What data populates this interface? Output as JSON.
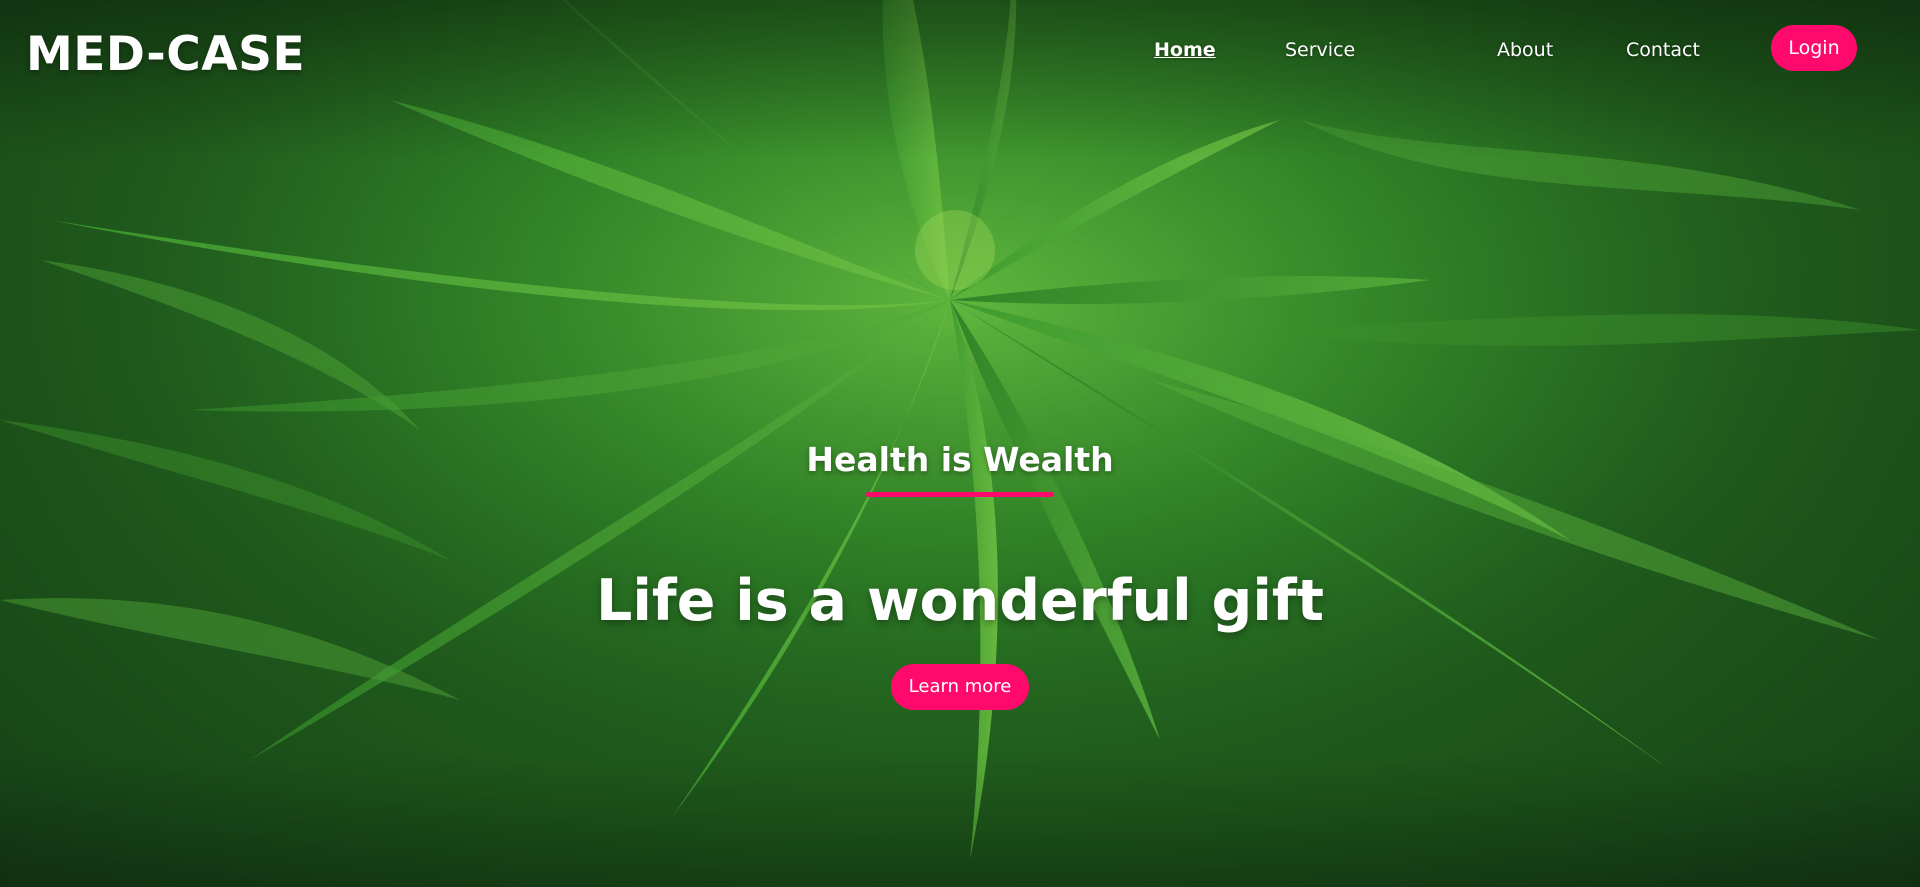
{
  "brand": {
    "title": "MED-CASE"
  },
  "nav": {
    "items": [
      {
        "label": "Home",
        "active": true
      },
      {
        "label": "Service",
        "active": false
      },
      {
        "label": "About",
        "active": false
      },
      {
        "label": "Contact",
        "active": false
      }
    ],
    "login_label": "Login"
  },
  "hero": {
    "tagline": "Health is Wealth",
    "headline": "Life is a wonderful gift",
    "cta_label": "Learn more",
    "background_image": "cannabis-plant-closeup"
  },
  "colors": {
    "accent": "#ff0a6c",
    "text": "#ffffff",
    "foliage": "#3f9a2e"
  }
}
